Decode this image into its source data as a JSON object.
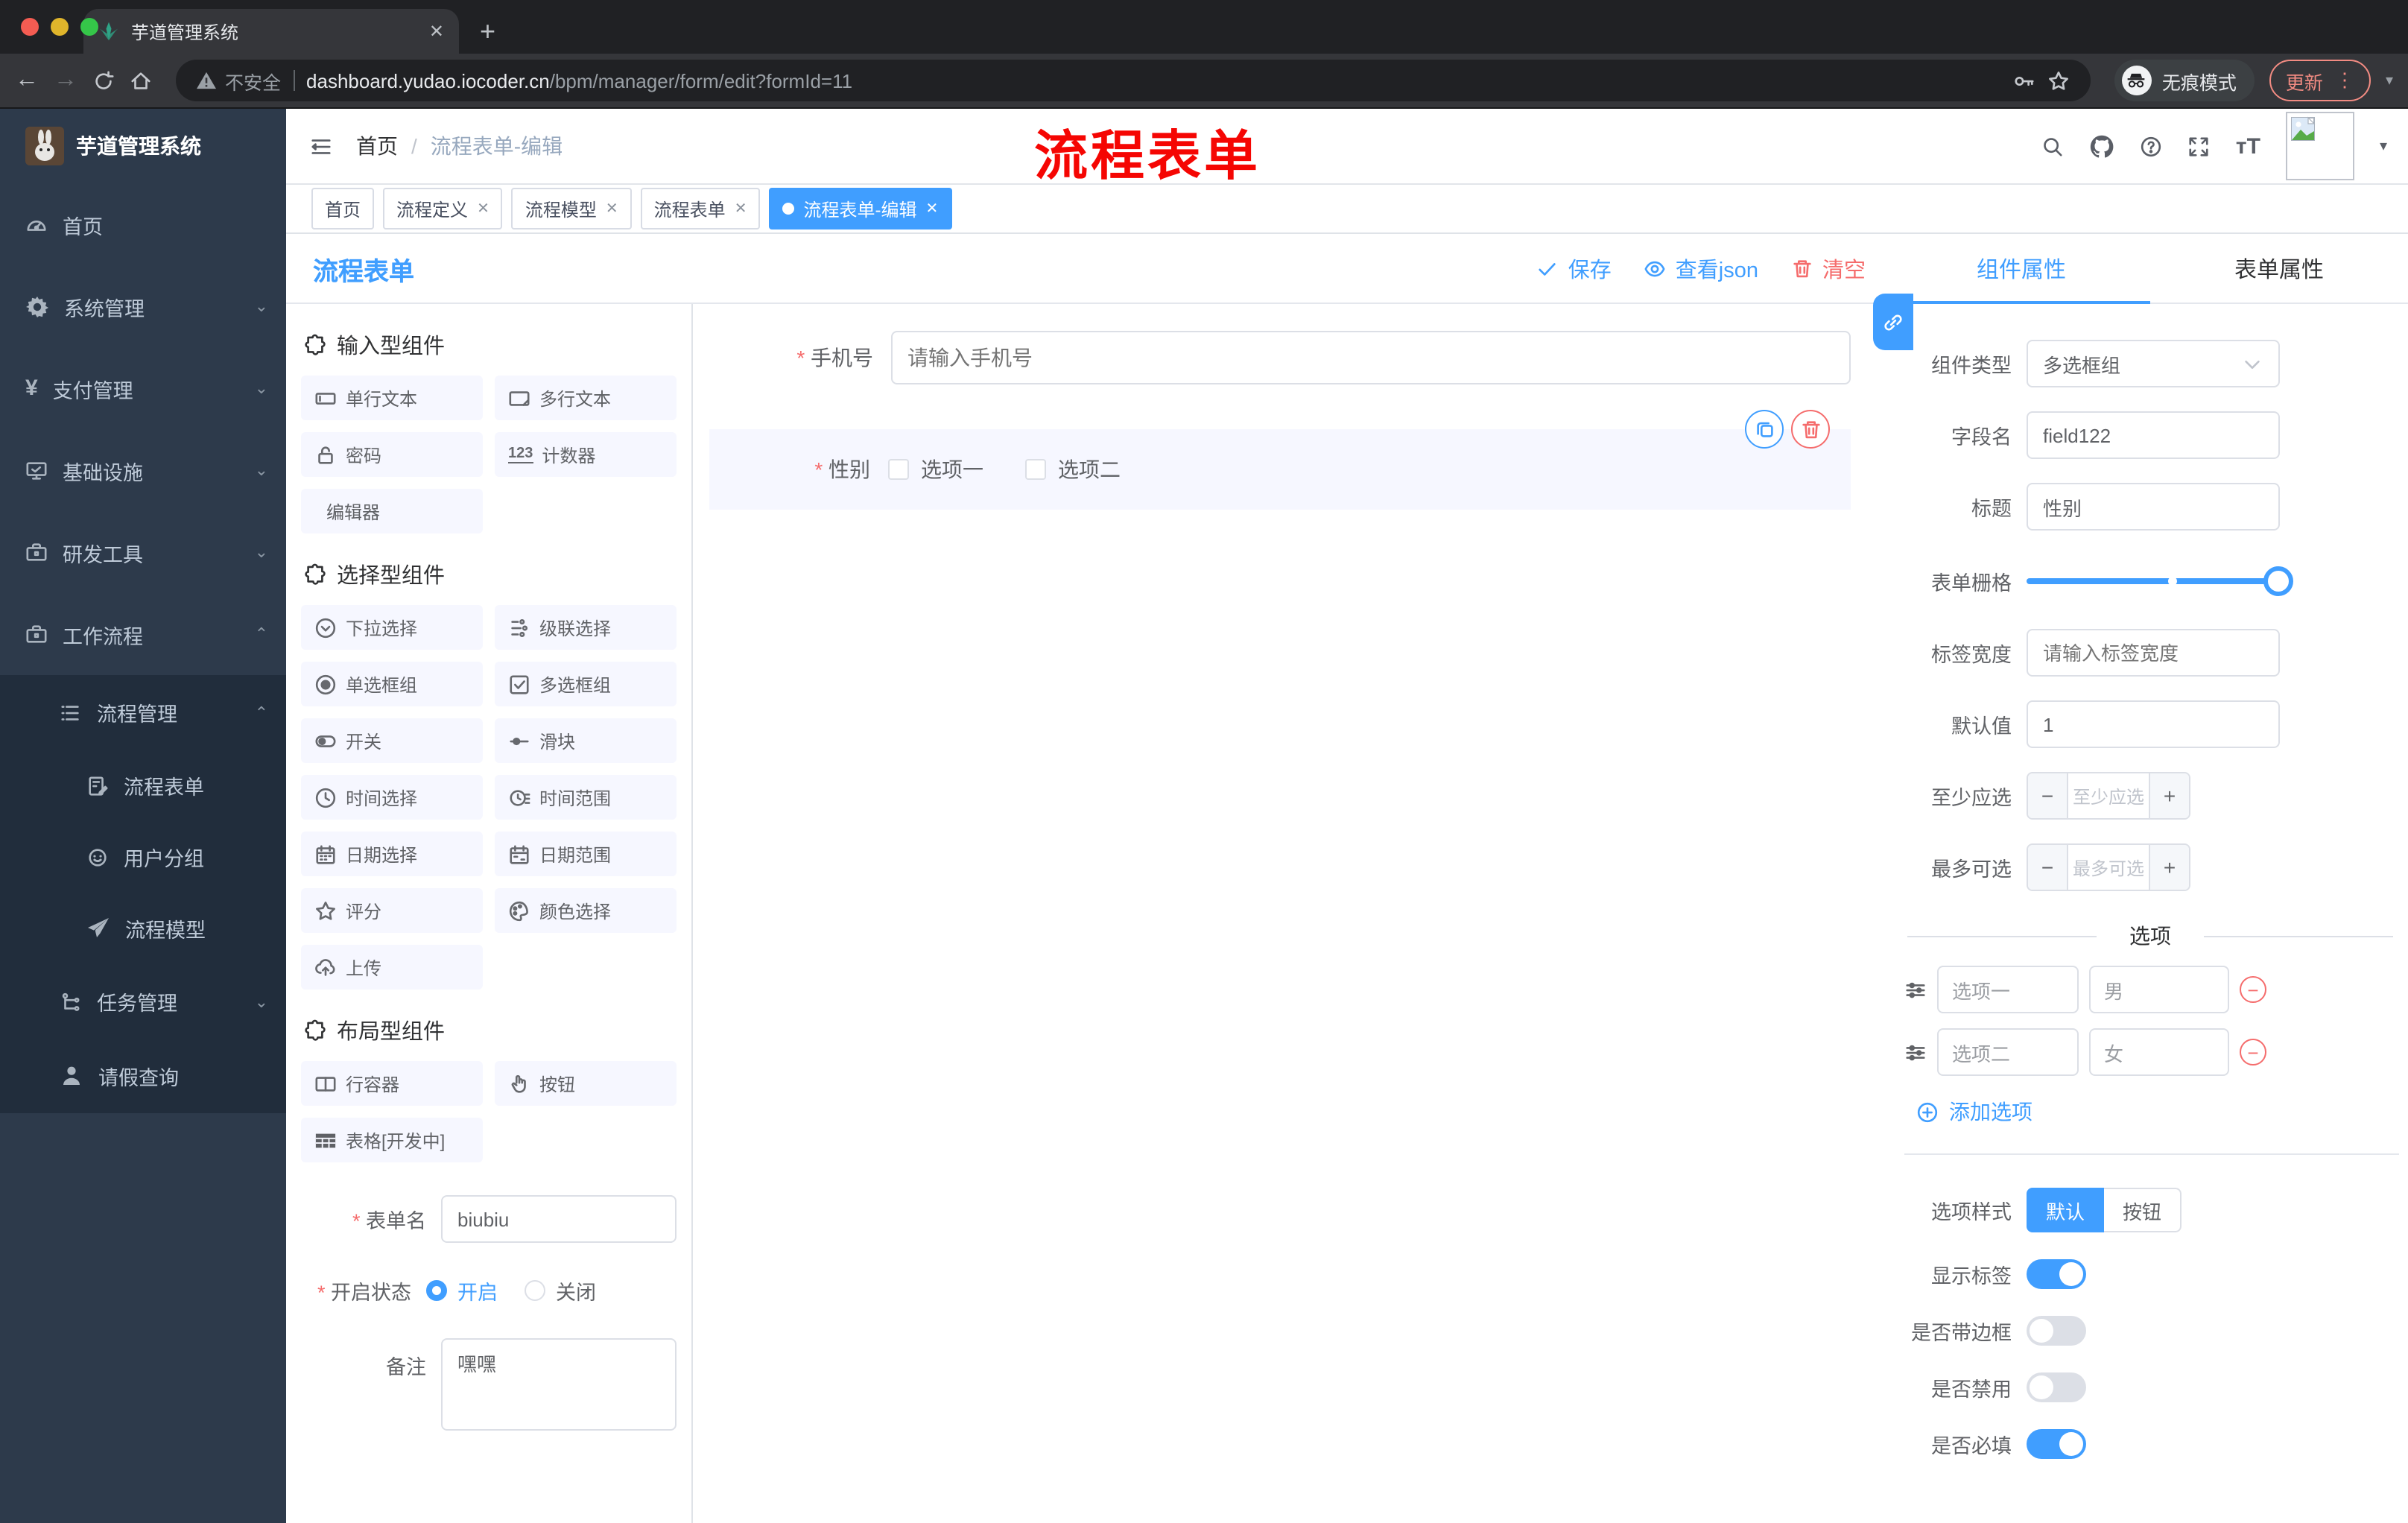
{
  "colors": {
    "accent": "#409eff",
    "danger": "#f56c6c",
    "watermark_red": "#f50603",
    "sidebar_bg": "#2d3a4b",
    "submenu_bg": "#212d3c",
    "item_bg": "#f6f7ff",
    "active_tag": "#409eff"
  },
  "browser": {
    "tab_title": "芋道管理系统",
    "security_text": "不安全",
    "url_host": "dashboard.yudao.iocoder.cn",
    "url_path": "/bpm/manager/form/edit?formId=11",
    "incognito_label": "无痕模式",
    "update_label": "更新",
    "menu_dots": "⋮"
  },
  "sidebar": {
    "title": "芋道管理系统",
    "items": [
      {
        "label": "首页",
        "icon": "dashboard",
        "level": 1,
        "arrow": ""
      },
      {
        "label": "系统管理",
        "icon": "gear",
        "level": 1,
        "arrow": "down"
      },
      {
        "label": "支付管理",
        "icon": "yen",
        "level": 1,
        "arrow": "down"
      },
      {
        "label": "基础设施",
        "icon": "monitor",
        "level": 1,
        "arrow": "down"
      },
      {
        "label": "研发工具",
        "icon": "briefcase",
        "level": 1,
        "arrow": "down"
      },
      {
        "label": "工作流程",
        "icon": "briefcase",
        "level": 1,
        "arrow": "up"
      },
      {
        "label": "流程管理",
        "icon": "listtree",
        "level": 2,
        "arrow": "up"
      },
      {
        "label": "流程表单",
        "icon": "docedit",
        "level": 3,
        "arrow": ""
      },
      {
        "label": "用户分组",
        "icon": "face",
        "level": 3,
        "arrow": ""
      },
      {
        "label": "流程模型",
        "icon": "plane",
        "level": 3,
        "arrow": ""
      },
      {
        "label": "任务管理",
        "icon": "flowtree",
        "level": 2,
        "arrow": "down"
      },
      {
        "label": "请假查询",
        "icon": "person",
        "level": 2,
        "arrow": ""
      }
    ]
  },
  "header": {
    "breadcrumb_home": "首页",
    "breadcrumb_sep": "/",
    "breadcrumb_current": "流程表单-编辑",
    "watermark": "流程表单"
  },
  "tags": [
    {
      "label": "首页",
      "closable": false,
      "active": false
    },
    {
      "label": "流程定义",
      "closable": true,
      "active": false
    },
    {
      "label": "流程模型",
      "closable": true,
      "active": false
    },
    {
      "label": "流程表单",
      "closable": true,
      "active": false
    },
    {
      "label": "流程表单-编辑",
      "closable": true,
      "active": true
    }
  ],
  "work": {
    "title": "流程表单",
    "toolbar": {
      "save": "保存",
      "view_json": "查看json",
      "clear": "清空"
    }
  },
  "palette": {
    "sections": [
      {
        "title": "输入型组件",
        "items": [
          {
            "label": "单行文本",
            "icon": "inputbox"
          },
          {
            "label": "多行文本",
            "icon": "textarea"
          },
          {
            "label": "密码",
            "icon": "lock"
          },
          {
            "label": "计数器",
            "icon": "counter"
          },
          {
            "label": "编辑器",
            "icon": "none"
          }
        ]
      },
      {
        "title": "选择型组件",
        "items": [
          {
            "label": "下拉选择",
            "icon": "dropdown"
          },
          {
            "label": "级联选择",
            "icon": "cascade"
          },
          {
            "label": "单选框组",
            "icon": "radio"
          },
          {
            "label": "多选框组",
            "icon": "checkbox"
          },
          {
            "label": "开关",
            "icon": "switch"
          },
          {
            "label": "滑块",
            "icon": "sliderico"
          },
          {
            "label": "时间选择",
            "icon": "clock"
          },
          {
            "label": "时间范围",
            "icon": "clockrange"
          },
          {
            "label": "日期选择",
            "icon": "calendar"
          },
          {
            "label": "日期范围",
            "icon": "calrange"
          },
          {
            "label": "评分",
            "icon": "star"
          },
          {
            "label": "颜色选择",
            "icon": "palette"
          },
          {
            "label": "上传",
            "icon": "upload"
          }
        ]
      },
      {
        "title": "布局型组件",
        "items": [
          {
            "label": "行容器",
            "icon": "columns"
          },
          {
            "label": "按钮",
            "icon": "hand"
          },
          {
            "label": "表格[开发中]",
            "icon": "tablegrid"
          }
        ]
      }
    ]
  },
  "meta_form": {
    "name_label": "表单名",
    "name_value": "biubiu",
    "status_label": "开启状态",
    "status_on": "开启",
    "status_off": "关闭",
    "remark_label": "备注",
    "remark_value": "嘿嘿"
  },
  "canvas": {
    "phone": {
      "label": "手机号",
      "placeholder": "请输入手机号"
    },
    "gender": {
      "label": "性别",
      "options": [
        "选项一",
        "选项二"
      ]
    }
  },
  "inspector": {
    "tab_component": "组件属性",
    "tab_form": "表单属性",
    "type": {
      "label": "组件类型",
      "value": "多选框组"
    },
    "field": {
      "label": "字段名",
      "value": "field122"
    },
    "title": {
      "label": "标题",
      "value": "性别"
    },
    "grid": {
      "label": "表单栅格"
    },
    "label_width": {
      "label": "标签宽度",
      "placeholder": "请输入标签宽度"
    },
    "default": {
      "label": "默认值",
      "value": "1"
    },
    "min": {
      "label": "至少应选",
      "placeholder": "至少应选"
    },
    "max": {
      "label": "最多可选",
      "placeholder": "最多可选"
    },
    "options": {
      "divider": "选项",
      "rows": [
        {
          "label": "选项一",
          "value": "男"
        },
        {
          "label": "选项二",
          "value": "女"
        }
      ],
      "add_label": "添加选项"
    },
    "style": {
      "label": "选项样式",
      "on": "默认",
      "off": "按钮"
    },
    "switches": [
      {
        "label": "显示标签",
        "on": true
      },
      {
        "label": "是否带边框",
        "on": false
      },
      {
        "label": "是否禁用",
        "on": false
      },
      {
        "label": "是否必填",
        "on": true
      }
    ]
  }
}
